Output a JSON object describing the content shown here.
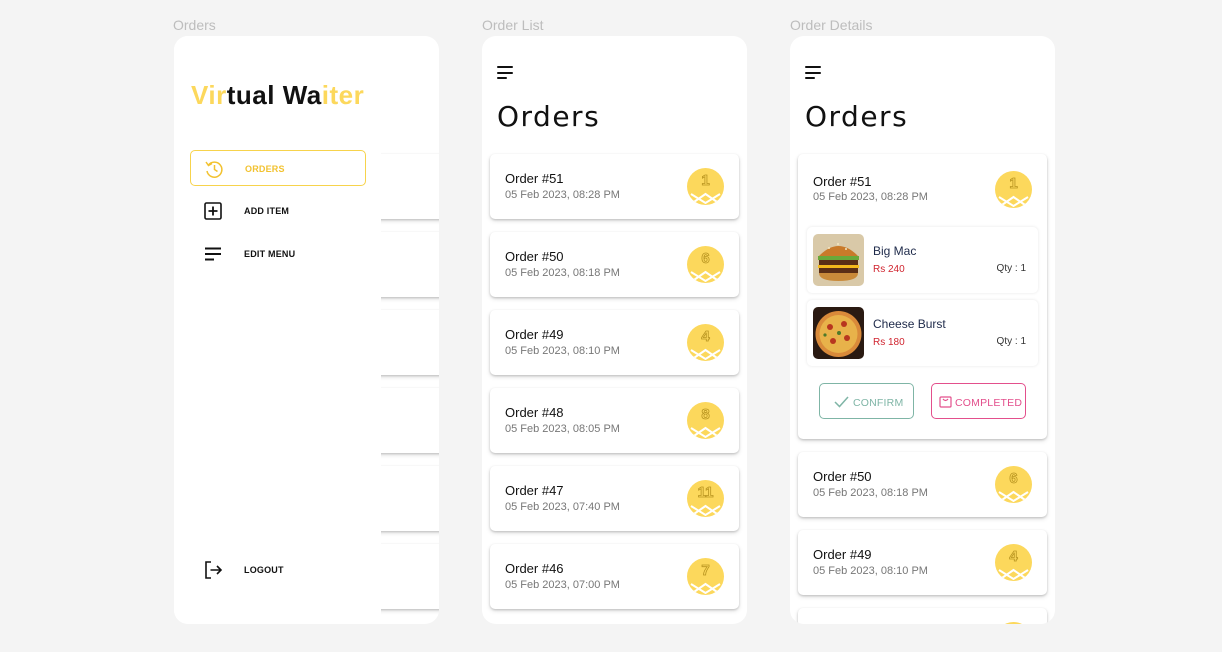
{
  "frames": {
    "drawer_label": "Orders",
    "list_label": "Order List",
    "details_label": "Order Details"
  },
  "brand": {
    "parts": [
      "Vir",
      "t",
      "ual ",
      "Wa",
      "iter"
    ]
  },
  "menu": {
    "orders": "ORDERS",
    "add_item": "ADD ITEM",
    "edit_menu": "EDIT MENU",
    "logout": "LOGOUT"
  },
  "page_title": "Orders",
  "orders": [
    {
      "id": "Order #51",
      "date": "05 Feb 2023, 08:28 PM",
      "table": "1"
    },
    {
      "id": "Order #50",
      "date": "05 Feb 2023, 08:18 PM",
      "table": "6"
    },
    {
      "id": "Order #49",
      "date": "05 Feb 2023, 08:10 PM",
      "table": "4"
    },
    {
      "id": "Order #48",
      "date": "05 Feb 2023, 08:05 PM",
      "table": "8"
    },
    {
      "id": "Order #47",
      "date": "05 Feb 2023, 07:40 PM",
      "table": "11"
    },
    {
      "id": "Order #46",
      "date": "05 Feb 2023, 07:00 PM",
      "table": "7"
    }
  ],
  "details": {
    "items": [
      {
        "name": "Big Mac",
        "price": "Rs 240",
        "qty": "Qty : 1",
        "image": "burger-image"
      },
      {
        "name": "Cheese Burst",
        "price": "Rs 180",
        "qty": "Qty : 1",
        "image": "pizza-image"
      }
    ],
    "confirm_label": "CONFIRM",
    "completed_label": "COMPLETED"
  },
  "colors": {
    "accent_yellow": "#fcd85c",
    "confirm_green": "#7fb5a6",
    "completed_pink": "#e34f8c",
    "price_red": "#d0242f"
  },
  "icons": [
    "menu-icon",
    "history-icon",
    "plus-square-icon",
    "list-icon",
    "logout-icon",
    "check-icon",
    "bag-icon",
    "table-badge-icon"
  ]
}
